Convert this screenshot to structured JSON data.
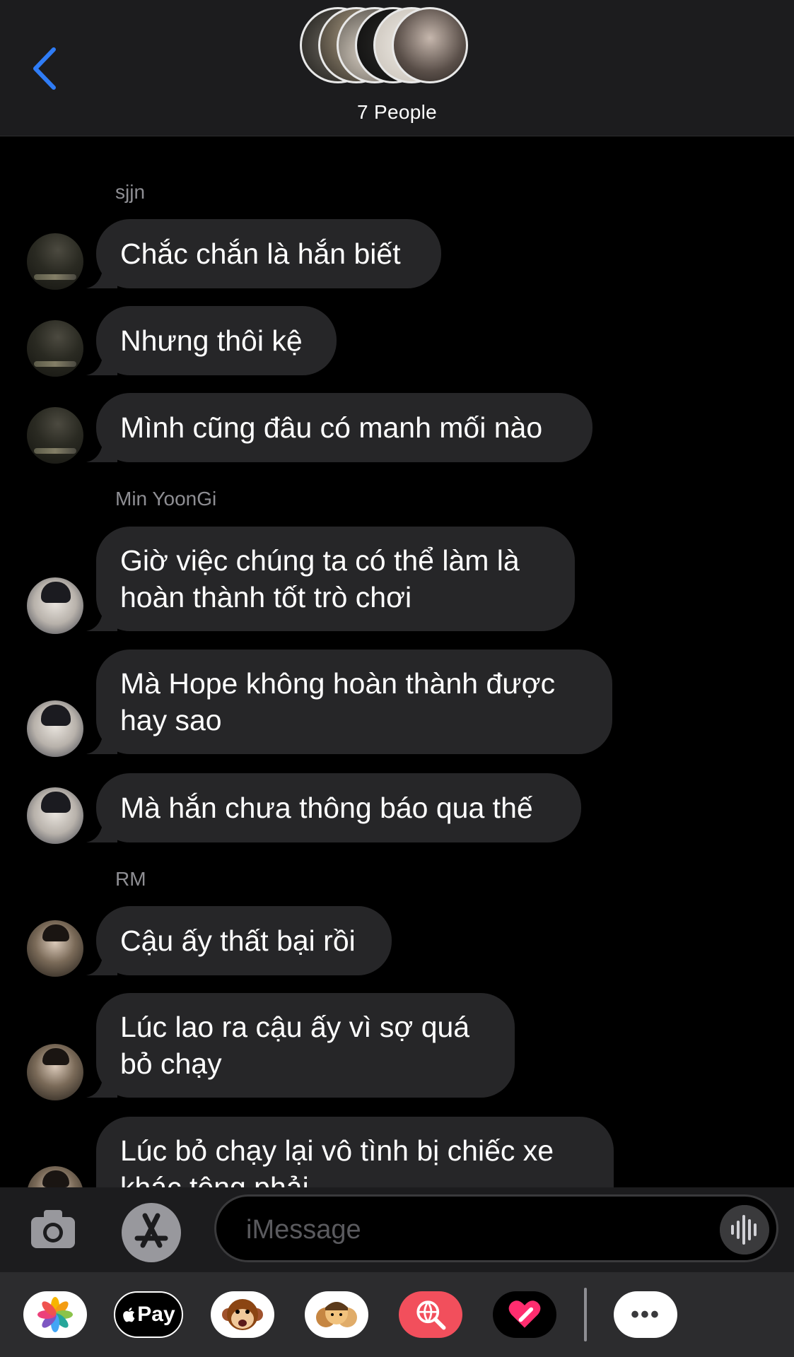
{
  "header": {
    "group_title": "7 People",
    "back_icon": "chevron-left-icon",
    "accent_color": "#2f7cf6"
  },
  "messages": {
    "sjjn_name": "sjjn",
    "sjjn_1": "Chắc chắn là hắn biết",
    "sjjn_2": "Nhưng thôi kệ",
    "sjjn_3": "Mình cũng đâu có manh mối nào",
    "yoongi_name": "Min YoonGi",
    "yoongi_1a": "Giờ việc chúng ta có thể làm là",
    "yoongi_1b": "hoàn thành tốt trò chơi",
    "yoongi_2a": "Mà Hope không hoàn thành được",
    "yoongi_2b": "hay sao",
    "yoongi_3": "Mà hắn chưa thông báo qua thế",
    "rm_name": "RM",
    "rm_1": "Cậu ấy thất bại rồi",
    "rm_2a": "Lúc lao ra cậu ấy vì sợ quá",
    "rm_2b": "bỏ chạy",
    "rm_3a": "Lúc bỏ chạy lại vô tình bị chiếc xe",
    "rm_3b": "khác tông phải"
  },
  "input": {
    "placeholder": "iMessage"
  },
  "drawer": {
    "apple_pay": "Pay",
    "more": "•••"
  }
}
